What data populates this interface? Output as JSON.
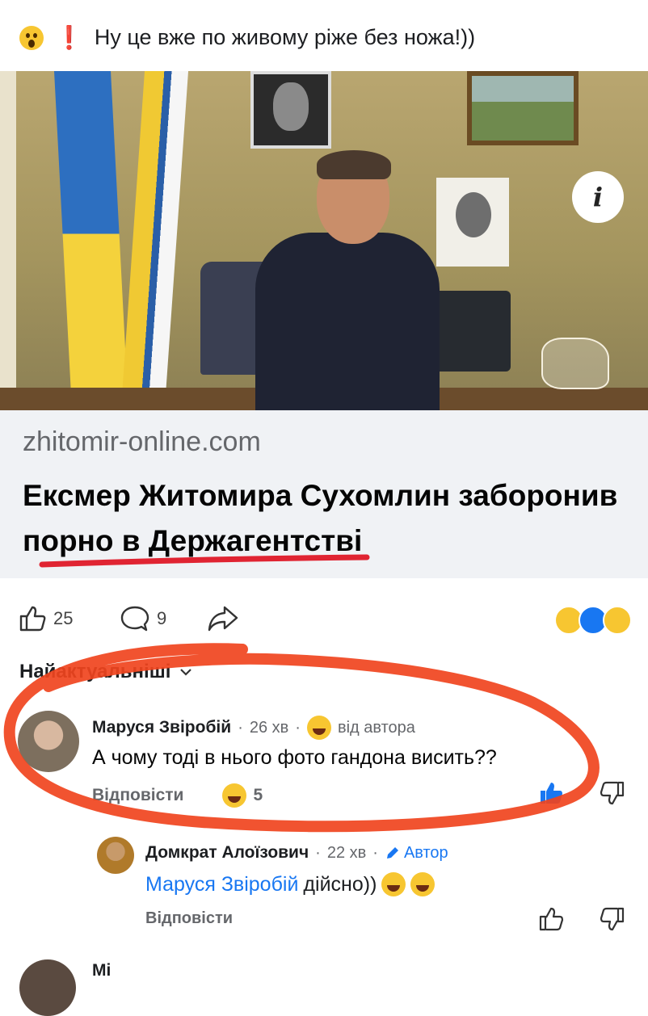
{
  "post": {
    "text": "Ну це вже по живому ріже без ножа!))",
    "emoji_icons": [
      "astonished-face-icon",
      "exclamation-mark-icon"
    ]
  },
  "link_preview": {
    "domain": "zhitomir-online.com",
    "title": "Ексмер Житомира Сухомлин заборонив порно в Держагентстві",
    "info_icon": "i"
  },
  "actions": {
    "like_count": "25",
    "comment_count": "9",
    "reactions": [
      "haha-reaction-icon",
      "like-reaction-icon",
      "wow-reaction-icon"
    ]
  },
  "comments_sort": {
    "label": "Найактуальніші"
  },
  "comments": [
    {
      "author": "Маруся Звіробій",
      "time": "26 хв",
      "badge": "від автора",
      "text": "А чому тоді в нього фото гандона висить??",
      "reply_label": "Відповісти",
      "reaction_count": "5",
      "liked": true
    },
    {
      "author": "Домкрат Алоїзович",
      "time": "22 хв",
      "badge": "Автор",
      "mention": "Маруся Звіробій",
      "text": "дійсно))",
      "reply_label": "Відповісти"
    }
  ],
  "next_comment": {
    "author": "Mi"
  },
  "colors": {
    "accent_blue": "#1877f2",
    "annotation_red": "#f0441e",
    "underline_red": "#e02432"
  }
}
